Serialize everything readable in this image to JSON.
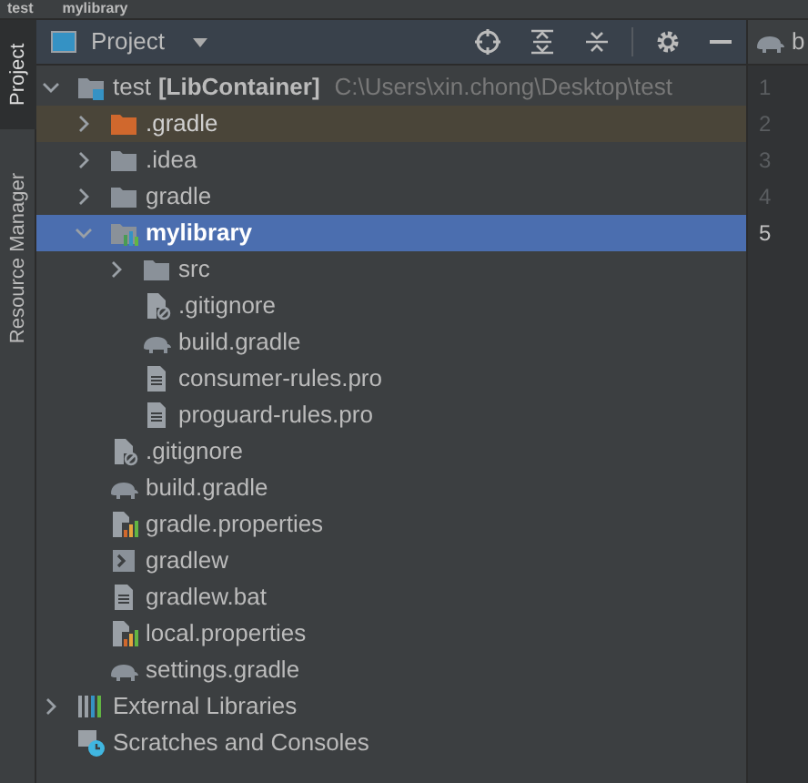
{
  "breadcrumb": [
    "test",
    "mylibrary"
  ],
  "side_strip": [
    {
      "label": "Project",
      "selected": true
    },
    {
      "label": "Resource Manager",
      "selected": false
    }
  ],
  "panel": {
    "title": "Project"
  },
  "tree": [
    {
      "kind": "module",
      "name": "test",
      "module": "[LibContainer]",
      "path": "C:\\Users\\xin.chong\\Desktop\\test",
      "expanded": true,
      "selected": false,
      "excluded": false,
      "children": [
        {
          "kind": "folder",
          "name": ".gradle",
          "expanded": false,
          "selected": false,
          "excluded": true
        },
        {
          "kind": "folder",
          "name": ".idea",
          "expanded": false,
          "selected": false,
          "excluded": false
        },
        {
          "kind": "folder",
          "name": "gradle",
          "expanded": false,
          "selected": false,
          "excluded": false
        },
        {
          "kind": "module",
          "name": "mylibrary",
          "expanded": true,
          "selected": true,
          "excluded": false,
          "children": [
            {
              "kind": "folder",
              "name": "src",
              "expanded": false,
              "selected": false,
              "excluded": false
            },
            {
              "kind": "ignore",
              "name": ".gitignore",
              "selected": false,
              "excluded": false
            },
            {
              "kind": "gradle",
              "name": "build.gradle",
              "selected": false,
              "excluded": false
            },
            {
              "kind": "text",
              "name": "consumer-rules.pro",
              "selected": false,
              "excluded": false
            },
            {
              "kind": "text",
              "name": "proguard-rules.pro",
              "selected": false,
              "excluded": false
            }
          ]
        },
        {
          "kind": "ignore",
          "name": ".gitignore",
          "selected": false,
          "excluded": false
        },
        {
          "kind": "gradle",
          "name": "build.gradle",
          "selected": false,
          "excluded": false
        },
        {
          "kind": "properties",
          "name": "gradle.properties",
          "selected": false,
          "excluded": false
        },
        {
          "kind": "shell",
          "name": "gradlew",
          "selected": false,
          "excluded": false
        },
        {
          "kind": "text",
          "name": "gradlew.bat",
          "selected": false,
          "excluded": false
        },
        {
          "kind": "properties",
          "name": "local.properties",
          "selected": false,
          "excluded": false
        },
        {
          "kind": "gradle",
          "name": "settings.gradle",
          "selected": false,
          "excluded": false
        }
      ]
    },
    {
      "kind": "libraries",
      "name": "External Libraries",
      "expanded": false,
      "selected": false,
      "excluded": false
    },
    {
      "kind": "scratches",
      "name": "Scratches and Consoles",
      "selected": false,
      "excluded": false
    }
  ],
  "editor": {
    "tab": "b",
    "lines": [
      {
        "number": "1",
        "current": false
      },
      {
        "number": "2",
        "current": false
      },
      {
        "number": "3",
        "current": false
      },
      {
        "number": "4",
        "current": false
      },
      {
        "number": "5",
        "current": true
      }
    ]
  }
}
